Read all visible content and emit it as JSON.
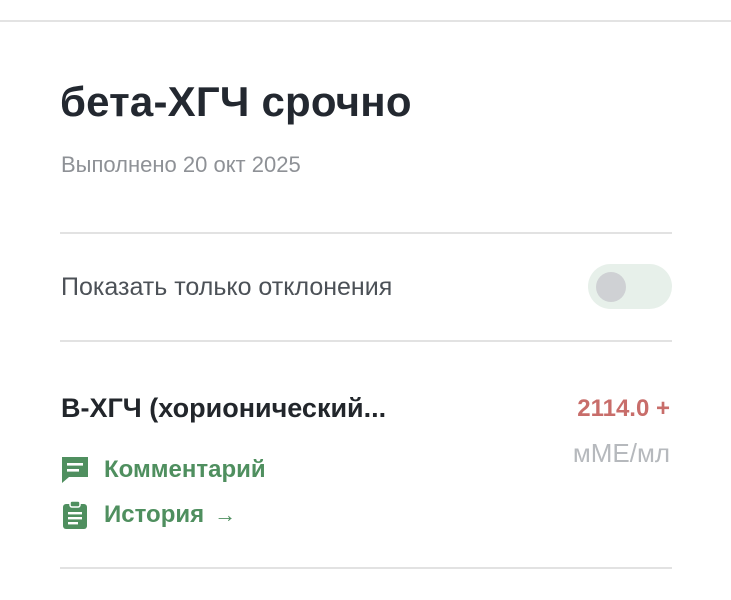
{
  "header": {
    "title": "бета-ХГЧ срочно",
    "completed": "Выполнено 20 окт 2025"
  },
  "filter": {
    "label": "Показать только отклонения",
    "toggle_on": false
  },
  "result": {
    "name": "B-ХГЧ (хорионический...",
    "value": "2114.0 +",
    "unit": "мМЕ/мл",
    "value_color": "#c86d6a",
    "comment_label": "Комментарий",
    "comment_icon": "comment-icon",
    "history_label": "История",
    "history_arrow": "→",
    "history_icon": "clipboard-icon",
    "link_color": "#4f8f5f"
  }
}
